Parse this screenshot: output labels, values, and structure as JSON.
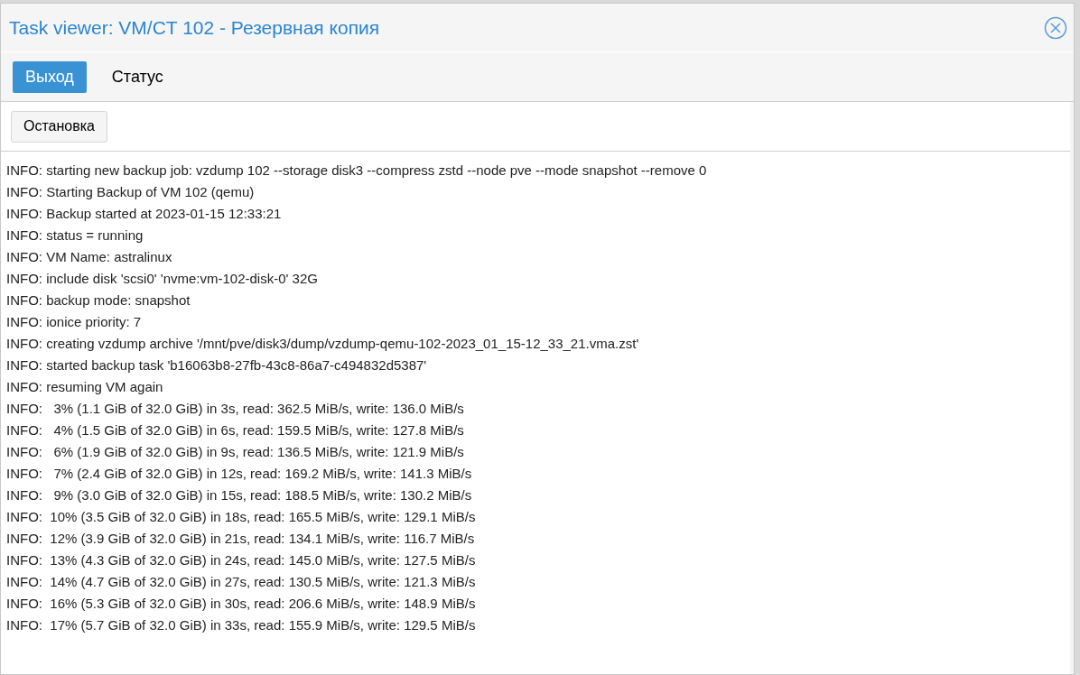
{
  "window": {
    "title": "Task viewer: VM/CT 102 - Резервная копия"
  },
  "tabs": [
    {
      "label": "Выход",
      "selected": true
    },
    {
      "label": "Статус",
      "selected": false
    }
  ],
  "toolbar": {
    "buttons": [
      "Остановка"
    ]
  },
  "log": {
    "lines": [
      "INFO: starting new backup job: vzdump 102 --storage disk3 --compress zstd --node pve --mode snapshot --remove 0",
      "INFO: Starting Backup of VM 102 (qemu)",
      "INFO: Backup started at 2023-01-15 12:33:21",
      "INFO: status = running",
      "INFO: VM Name: astralinux",
      "INFO: include disk 'scsi0' 'nvme:vm-102-disk-0' 32G",
      "INFO: backup mode: snapshot",
      "INFO: ionice priority: 7",
      "INFO: creating vzdump archive '/mnt/pve/disk3/dump/vzdump-qemu-102-2023_01_15-12_33_21.vma.zst'",
      "INFO: started backup task 'b16063b8-27fb-43c8-86a7-c494832d5387'",
      "INFO: resuming VM again",
      "INFO:   3% (1.1 GiB of 32.0 GiB) in 3s, read: 362.5 MiB/s, write: 136.0 MiB/s",
      "INFO:   4% (1.5 GiB of 32.0 GiB) in 6s, read: 159.5 MiB/s, write: 127.8 MiB/s",
      "INFO:   6% (1.9 GiB of 32.0 GiB) in 9s, read: 136.5 MiB/s, write: 121.9 MiB/s",
      "INFO:   7% (2.4 GiB of 32.0 GiB) in 12s, read: 169.2 MiB/s, write: 141.3 MiB/s",
      "INFO:   9% (3.0 GiB of 32.0 GiB) in 15s, read: 188.5 MiB/s, write: 130.2 MiB/s",
      "INFO:  10% (3.5 GiB of 32.0 GiB) in 18s, read: 165.5 MiB/s, write: 129.1 MiB/s",
      "INFO:  12% (3.9 GiB of 32.0 GiB) in 21s, read: 134.1 MiB/s, write: 116.7 MiB/s",
      "INFO:  13% (4.3 GiB of 32.0 GiB) in 24s, read: 145.0 MiB/s, write: 127.5 MiB/s",
      "INFO:  14% (4.7 GiB of 32.0 GiB) in 27s, read: 130.5 MiB/s, write: 121.3 MiB/s",
      "INFO:  16% (5.3 GiB of 32.0 GiB) in 30s, read: 206.6 MiB/s, write: 148.9 MiB/s",
      "INFO:  17% (5.7 GiB of 32.0 GiB) in 33s, read: 155.9 MiB/s, write: 129.5 MiB/s"
    ]
  }
}
